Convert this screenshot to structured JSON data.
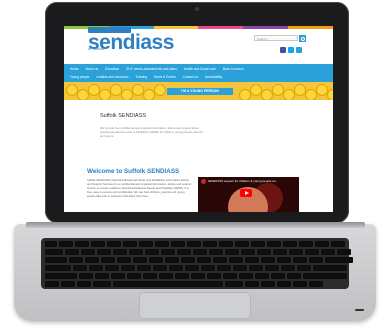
{
  "site": {
    "logo_text": "sendiass",
    "logo_sub": "in Suffolk",
    "search_placeholder": "Search...",
    "colors": {
      "brand_blue": "#2f7fc3",
      "nav_blue": "#2aa1d8",
      "banner_yellow": "#f6c43a",
      "heading_blue": "#2f7fc3"
    },
    "colorbar": [
      "#8cc63f",
      "#2aa1d8",
      "#f6c43a",
      "#e84d8a",
      "#8e44ad",
      "#f39c12"
    ],
    "social_icons": [
      "facebook-icon",
      "twitter-icon",
      "youtube-icon"
    ]
  },
  "nav": {
    "row1": [
      "Home",
      "About us",
      "Education",
      "EHC needs assessments and plans",
      "Health and Social care",
      "Back to school"
    ],
    "row2": [
      "Young people",
      "Leaflets and resources",
      "Training",
      "News & Events",
      "Contact us",
      "Accessibility"
    ]
  },
  "banner": {
    "label": "I'M A YOUNG PERSON"
  },
  "content": {
    "title1": "Suffolk SENDIASS",
    "intro": "We provide free confidential and impartial information, advice and support about special educational needs & disabilities (SEND) for children, young people, parents and carers.",
    "title2": "Welcome to Suffolk SENDIASS",
    "body": "Suffolk SENDIASS (Special Educational Needs and Disabilities Information Advice and Support Services) is a confidential and impartial information, advice and support service on issues related to Special Educational Needs and Disability (SEND). It is free, easy to access and confidential. We can help children, parents and young people take part in decisions that affect their lives."
  },
  "video": {
    "title": "SENDIASS support for children & young people an..."
  }
}
